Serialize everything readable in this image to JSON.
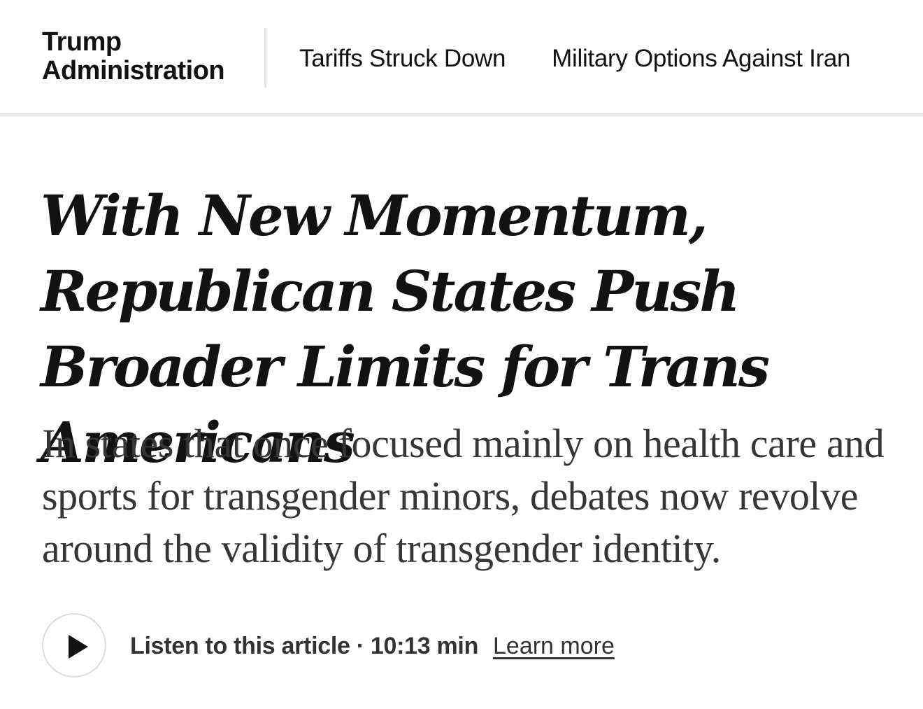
{
  "nav": {
    "section_title_line1": "Trump",
    "section_title_line2": "Administration",
    "links": [
      {
        "label": "Tariffs Struck Down"
      },
      {
        "label": "Military Options Against Iran"
      }
    ]
  },
  "article": {
    "headline": "With New Momentum, Republican States Push Broader Limits for Trans Americans",
    "summary": "In states that once focused mainly on health care and sports for transgender minors, debates now revolve around the validity of transgender identity."
  },
  "audio": {
    "play_icon": "play-icon",
    "listen_label": "Listen to this article · 10:13 min",
    "learn_more": "Learn more"
  }
}
